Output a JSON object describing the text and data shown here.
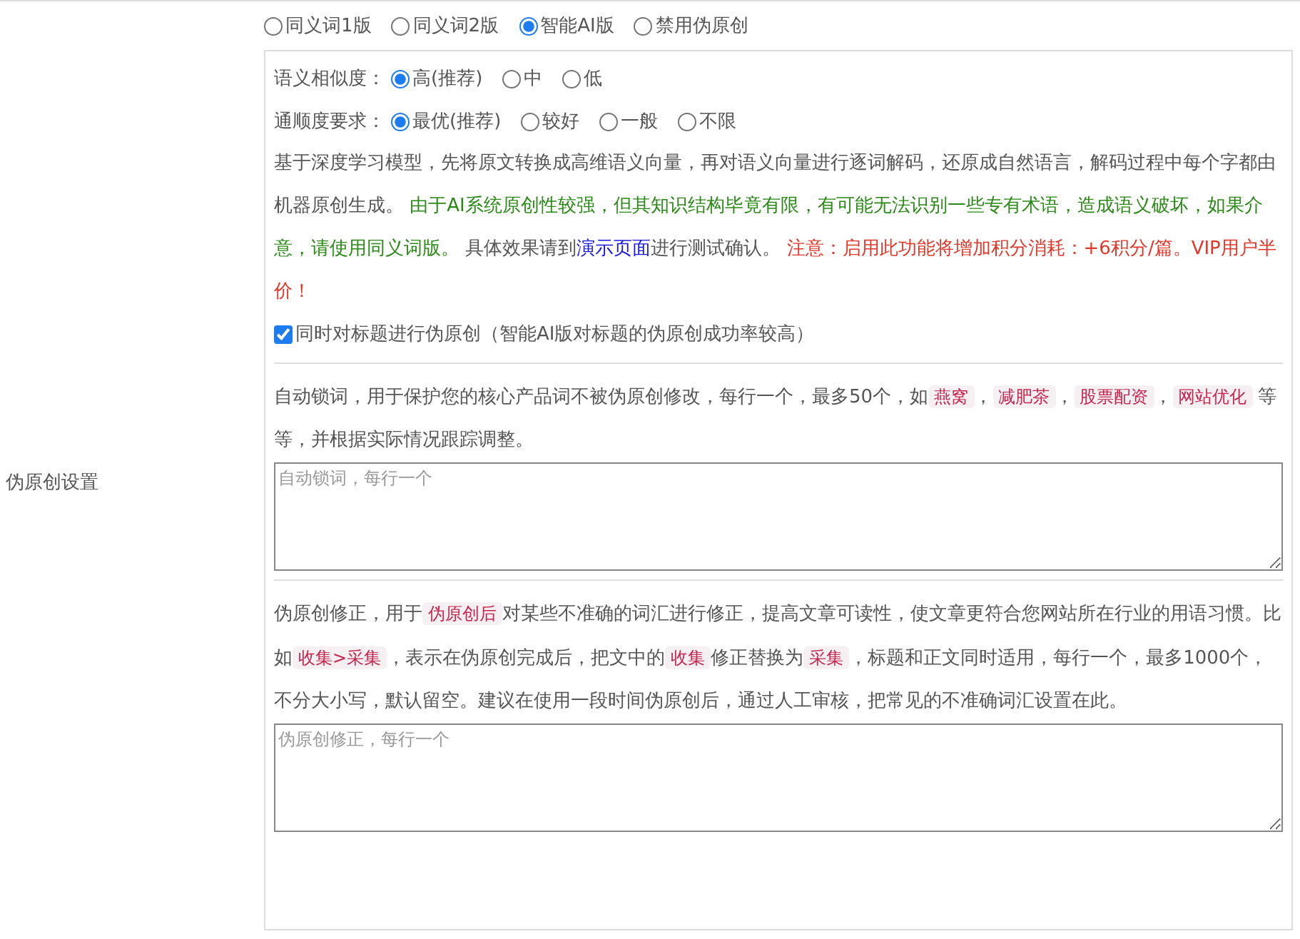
{
  "version_options": [
    {
      "label": "同义词1版",
      "selected": false
    },
    {
      "label": "同义词2版",
      "selected": false
    },
    {
      "label": "智能AI版",
      "selected": true
    },
    {
      "label": "禁用伪原创",
      "selected": false
    }
  ],
  "settings_label": "伪原创设置",
  "similarity": {
    "label": "语义相似度：",
    "options": [
      {
        "label": "高(推荐)",
        "selected": true
      },
      {
        "label": "中",
        "selected": false
      },
      {
        "label": "低",
        "selected": false
      }
    ]
  },
  "fluency": {
    "label": "通顺度要求：",
    "options": [
      {
        "label": "最优(推荐)",
        "selected": true
      },
      {
        "label": "较好",
        "selected": false
      },
      {
        "label": "一般",
        "selected": false
      },
      {
        "label": "不限",
        "selected": false
      }
    ]
  },
  "description": [
    {
      "kind": "text",
      "text": "基于深度学习模型，先将原文转换成高维语义向量，再对语义向量进行逐词解码，还原成自然语言，解码过程中每个字都由机器原创生成。 "
    },
    {
      "kind": "notice",
      "text": "由于AI系统原创性较强，但其知识结构毕竟有限，有可能无法识别一些专有术语，造成语义破坏，如果介意，请使用同义词版。"
    },
    {
      "kind": "text",
      "text": " 具体效果请到"
    },
    {
      "kind": "link",
      "text": "演示页面"
    },
    {
      "kind": "text",
      "text": "进行测试确认。 "
    },
    {
      "kind": "warning",
      "text": "注意：启用此功能将增加积分消耗：+6积分/篇。VIP用户半价！"
    }
  ],
  "title_option": {
    "label": "同时对标题进行伪原创（智能AI版对标题的伪原创成功率较高）",
    "checked": true
  },
  "lock_words": {
    "description": [
      {
        "kind": "text",
        "text": "自动锁词，用于保护您的核心产品词不被伪原创修改，每行一个，最多50个，如"
      },
      {
        "kind": "tag",
        "text": "燕窝"
      },
      {
        "kind": "text",
        "text": "，"
      },
      {
        "kind": "tag",
        "text": "减肥茶"
      },
      {
        "kind": "text",
        "text": "，"
      },
      {
        "kind": "tag",
        "text": "股票配资"
      },
      {
        "kind": "text",
        "text": "，"
      },
      {
        "kind": "tag",
        "text": "网站优化"
      },
      {
        "kind": "text",
        "text": " 等等，并根据实际情况跟踪调整。"
      }
    ],
    "placeholder": "自动锁词，每行一个"
  },
  "correction": {
    "description": [
      {
        "kind": "text",
        "text": "伪原创修正，用于"
      },
      {
        "kind": "tag",
        "text": "伪原创后"
      },
      {
        "kind": "text",
        "text": "对某些不准确的词汇进行修正，提高文章可读性，使文章更符合您网站所在行业的用语习惯。比如"
      },
      {
        "kind": "tag",
        "text": "收集>采集"
      },
      {
        "kind": "text",
        "text": "，表示在伪原创完成后，把文中的"
      },
      {
        "kind": "tag",
        "text": "收集"
      },
      {
        "kind": "text",
        "text": "修正替换为"
      },
      {
        "kind": "tag",
        "text": "采集"
      },
      {
        "kind": "text",
        "text": "，标题和正文同时适用，每行一个，最多1000个，不分大小写，默认留空。建议在使用一段时间伪原创后，通过人工审核，把常见的不准确词汇设置在此。"
      }
    ],
    "placeholder": "伪原创修正，每行一个"
  }
}
